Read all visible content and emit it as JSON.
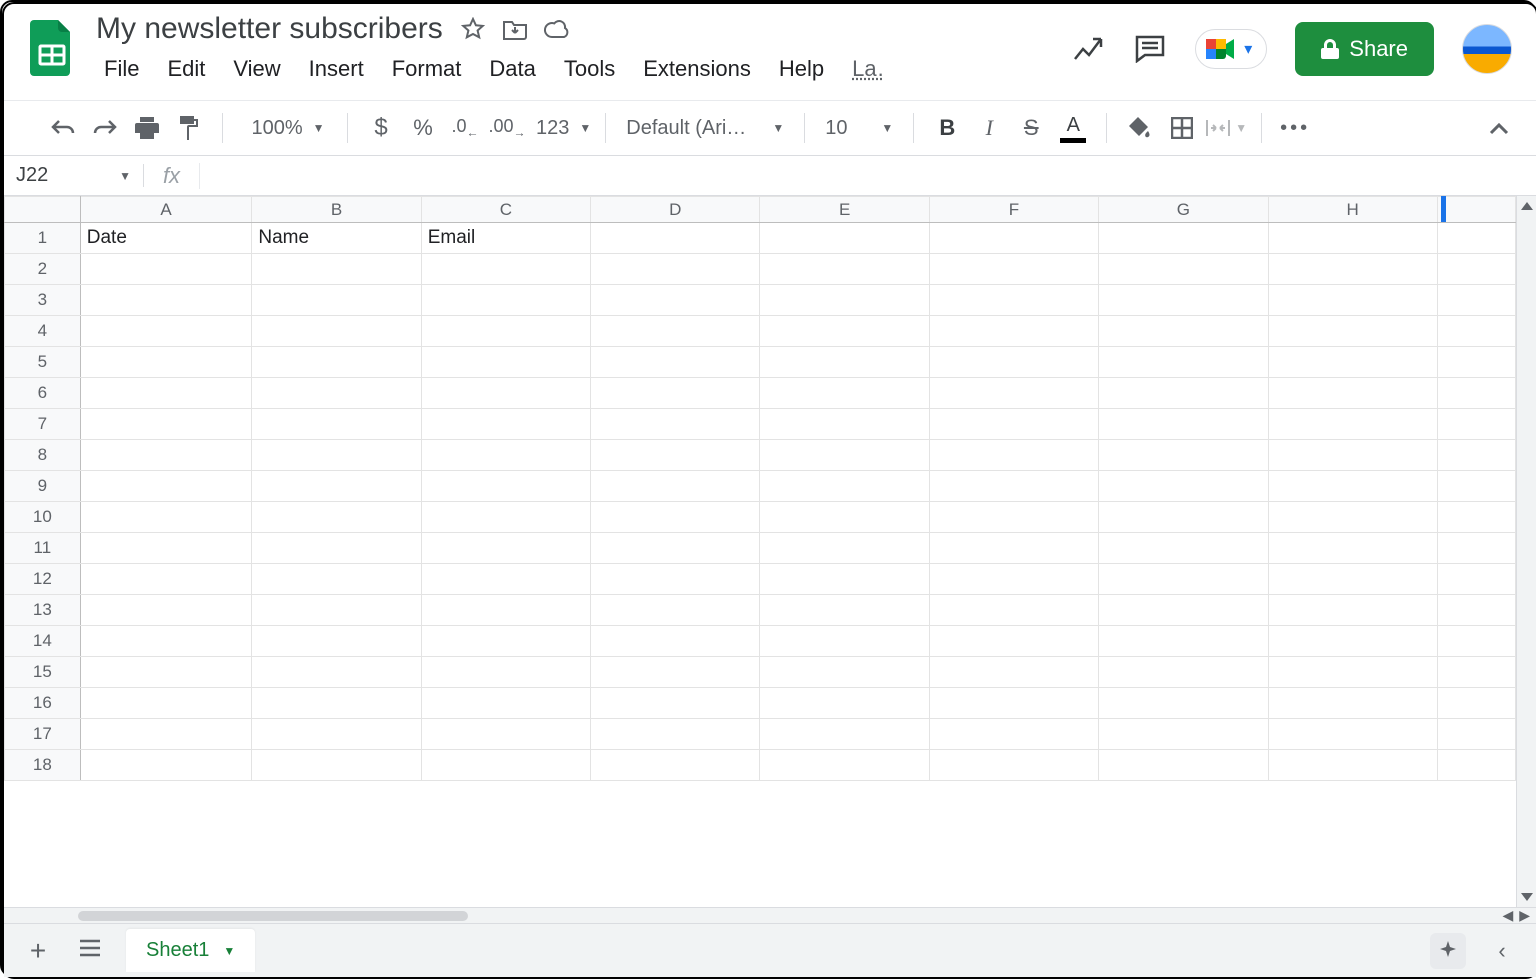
{
  "doc": {
    "title": "My newsletter subscribers"
  },
  "menus": [
    "File",
    "Edit",
    "View",
    "Insert",
    "Format",
    "Data",
    "Tools",
    "Extensions",
    "Help",
    "La…"
  ],
  "share_label": "Share",
  "toolbar": {
    "zoom": "100%",
    "number_123": "123",
    "font": "Default (Ari…",
    "font_size": "10"
  },
  "name_box": "J22",
  "fx_symbol": "fx",
  "columns": [
    "A",
    "B",
    "C",
    "D",
    "E",
    "F",
    "G",
    "H",
    ""
  ],
  "row_count": 18,
  "cells": {
    "1": {
      "A": "Date",
      "B": "Name",
      "C": "Email"
    }
  },
  "sheet_tab": "Sheet1"
}
